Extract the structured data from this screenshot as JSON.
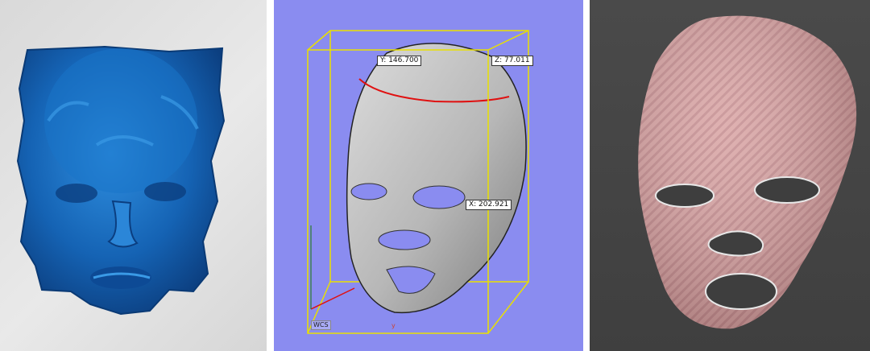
{
  "panels": {
    "scan": {
      "icon": "face-scan-image"
    },
    "cad": {
      "label_y": "Y: 146.700",
      "label_z": "Z: 77.011",
      "label_x": "X: 202.921",
      "coord_label": "WCS",
      "axis_label": "y"
    },
    "render": {
      "icon": "face-mask-render"
    }
  },
  "colors": {
    "scan_blue": "#1e6fc0",
    "cad_bg": "#8a8cf0",
    "bbox_yellow": "#e9e000",
    "render_pink": "#d9a3a3"
  }
}
